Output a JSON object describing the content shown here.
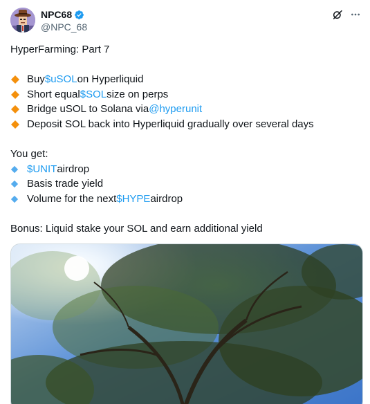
{
  "author": {
    "display_name": "NPC68",
    "handle": "@NPC_68",
    "verified": true,
    "avatar_icon": "avatar-icon"
  },
  "actions": {
    "grok_icon": "grok-icon",
    "more_icon": "more-options-icon"
  },
  "tweet": {
    "title": "HyperFarming: Part 7",
    "steps": [
      {
        "pre": "Buy ",
        "link": "$uSOL",
        "post": " on Hyperliquid"
      },
      {
        "pre": "Short equal ",
        "link": "$SOL",
        "post": " size on perps"
      },
      {
        "pre": "Bridge uSOL to Solana via ",
        "link": "@hyperunit",
        "post": ""
      },
      {
        "pre": "Deposit SOL back into Hyperliquid gradually over several days",
        "link": "",
        "post": ""
      }
    ],
    "you_get_label": "You get:",
    "benefits": [
      {
        "pre": "",
        "link": "$UNIT",
        "post": " airdrop"
      },
      {
        "pre": "Basis trade yield",
        "link": "",
        "post": ""
      },
      {
        "pre": "Volume for the next ",
        "link": "$HYPE",
        "post": " airdrop"
      }
    ],
    "bonus": "Bonus: Liquid stake your SOL and earn additional yield"
  },
  "colors": {
    "text": "#0f1419",
    "secondary": "#536471",
    "link": "#1d9bf0",
    "orange_diamond": "#f4900c",
    "blue_diamond": "#55acee",
    "verified": "#1d9bf0"
  }
}
